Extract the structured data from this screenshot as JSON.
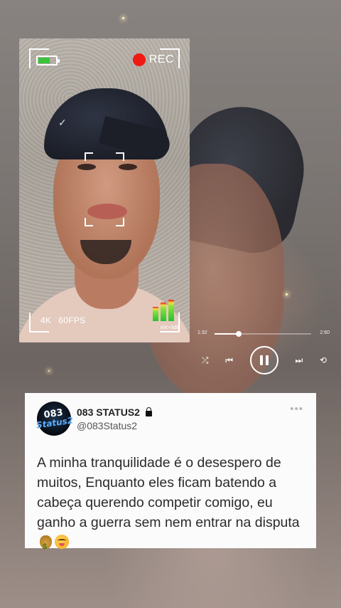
{
  "camera": {
    "rec_label": "REC",
    "resolution": "4K",
    "fps": "60FPS",
    "meter_label": "mic+3dB",
    "battery_level": 0.6,
    "battery_color": "#3ac43a",
    "rec_color": "#f01a14"
  },
  "player": {
    "elapsed": "1:32",
    "duration": "2:60",
    "progress": 0.25,
    "icons": [
      "shuffle-icon",
      "previous-icon",
      "pause-icon",
      "next-icon",
      "repeat-icon"
    ]
  },
  "tweet": {
    "avatar_text_top": "083",
    "avatar_text_bottom": "Status2",
    "display_name": "083 STATUS2",
    "handle": "@083Status2",
    "more_label": "•••",
    "text": "A minha tranquilidade é o desespero de muitos, Enquanto eles ficam batendo a cabeça querendo competir comigo, eu ganho a guerra sem nem entrar na disputa",
    "emojis": [
      "money-bag-icon",
      "partying-face-icon"
    ]
  }
}
